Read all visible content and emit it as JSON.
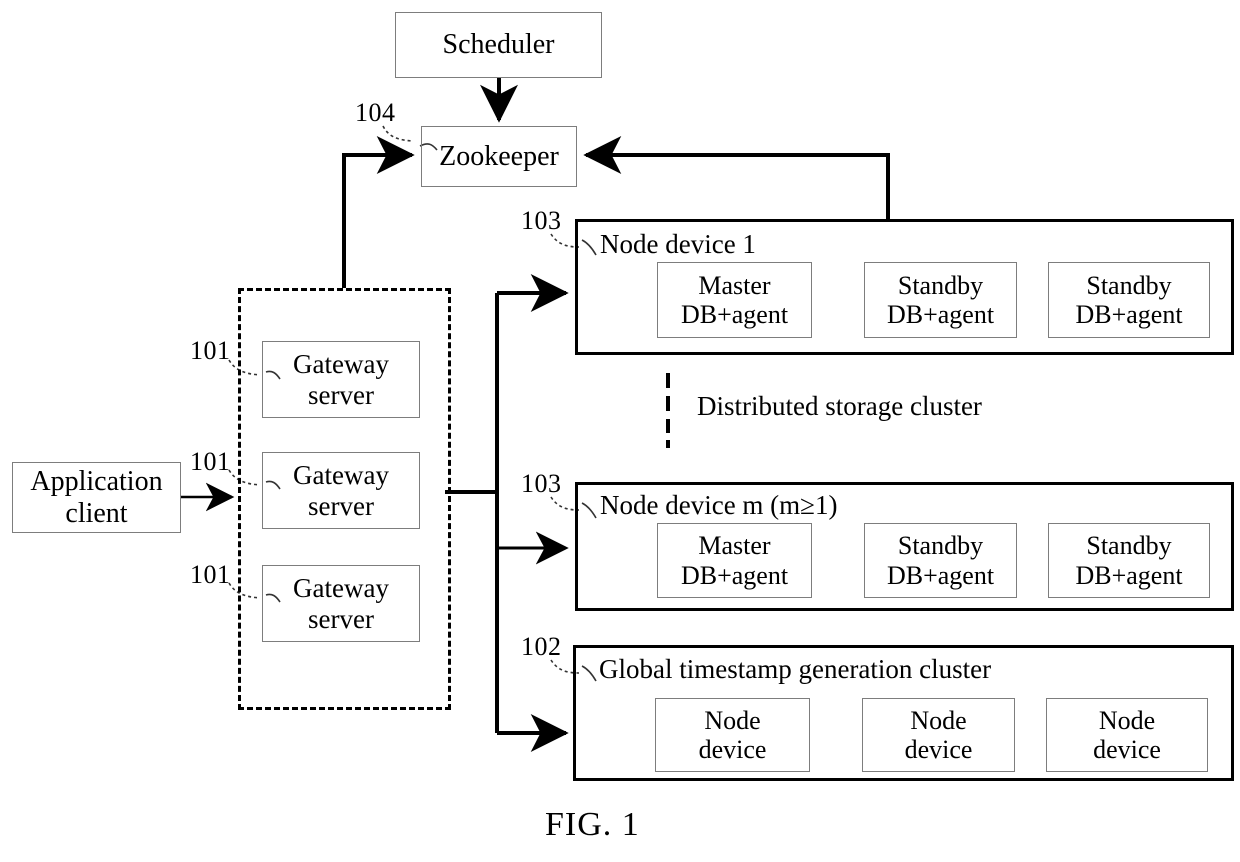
{
  "figure": {
    "caption": "FIG. 1",
    "title_text": "Distributed storage cluster"
  },
  "nodes": {
    "scheduler": {
      "label": "Scheduler"
    },
    "zookeeper": {
      "label": "Zookeeper",
      "ref": "104"
    },
    "application_client": {
      "label_line1": "Application",
      "label_line2": "client"
    },
    "gateway_group": {
      "ref_labels": [
        "101",
        "101",
        "101"
      ],
      "servers": [
        {
          "line1": "Gateway",
          "line2": "server"
        },
        {
          "line1": "Gateway",
          "line2": "server"
        },
        {
          "line1": "Gateway",
          "line2": "server"
        }
      ]
    },
    "node_device_1": {
      "ref": "103",
      "title": "Node device 1",
      "units": [
        {
          "line1": "Master",
          "line2": "DB+agent"
        },
        {
          "line1": "Standby",
          "line2": "DB+agent"
        },
        {
          "line1": "Standby",
          "line2": "DB+agent"
        }
      ]
    },
    "node_device_m": {
      "ref": "103",
      "title": "Node device m (m≥1)",
      "units": [
        {
          "line1": "Master",
          "line2": "DB+agent"
        },
        {
          "line1": "Standby",
          "line2": "DB+agent"
        },
        {
          "line1": "Standby",
          "line2": "DB+agent"
        }
      ]
    },
    "timestamp_cluster": {
      "ref": "102",
      "title": "Global timestamp generation cluster",
      "units": [
        {
          "line1": "Node",
          "line2": "device"
        },
        {
          "line1": "Node",
          "line2": "device"
        },
        {
          "line1": "Node",
          "line2": "device"
        }
      ]
    }
  },
  "colors": {
    "stroke": "#000000",
    "thin_stroke": "#7d7d7d",
    "background": "#ffffff"
  }
}
